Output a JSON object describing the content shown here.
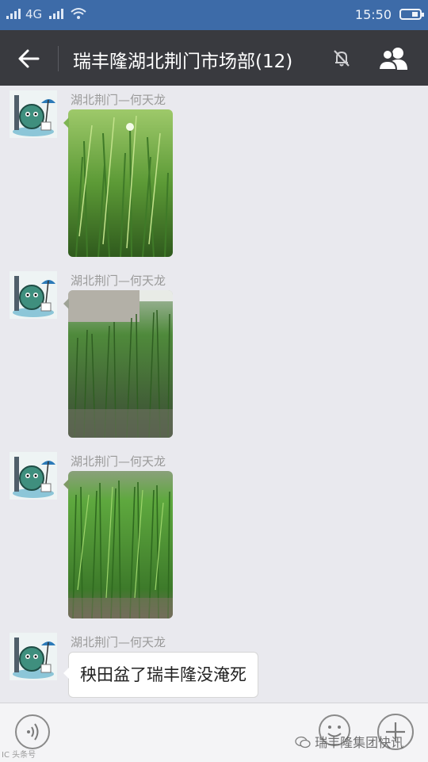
{
  "status": {
    "carrier": "4G",
    "time": "15:50"
  },
  "header": {
    "title": "瑞丰隆湖北荆门市场部(12)"
  },
  "messages": [
    {
      "sender": "湖北荆门—何天龙",
      "type": "image"
    },
    {
      "sender": "湖北荆门—何天龙",
      "type": "image"
    },
    {
      "sender": "湖北荆门—何天龙",
      "type": "image"
    },
    {
      "sender": "湖北荆门—何天龙",
      "type": "text",
      "text": "秧田盆了瑞丰隆没淹死"
    }
  ],
  "watermark": {
    "text": "瑞丰隆集团快讯",
    "corner": "IC 头条号"
  },
  "icons": {
    "back": "arrow-left-icon",
    "mute": "bell-off-icon",
    "group": "group-icon",
    "voice": "voice-icon",
    "emoji": "emoji-icon",
    "plus": "plus-icon"
  }
}
